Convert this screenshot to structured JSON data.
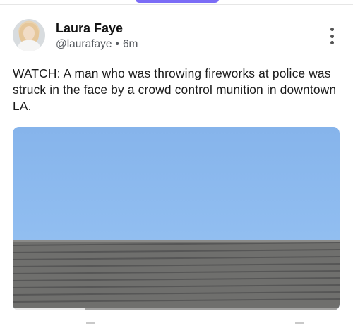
{
  "post": {
    "author_name": "Laura Faye",
    "handle": "@laurafaye",
    "separator": "•",
    "time_ago": "6m",
    "text": "WATCH: A man who was throwing fireworks at police was struck in the face by a crowd control munition in downtown LA."
  },
  "media": {
    "type": "video",
    "progress": 0.22
  },
  "icons": {
    "more": "more-vertical-icon",
    "avatar": "avatar-image"
  },
  "colors": {
    "accent": "#7b6cf6",
    "text": "#1a1a1a",
    "muted": "#55595e",
    "sky": "#8cb9ee"
  }
}
